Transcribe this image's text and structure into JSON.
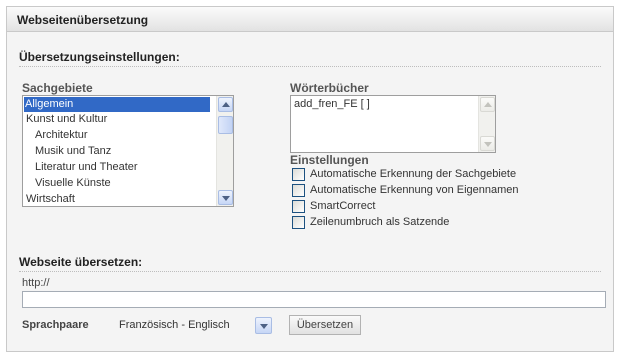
{
  "panel": {
    "title": "Webseitenübersetzung"
  },
  "settings": {
    "title": "Übersetzungseinstellungen:",
    "subject_areas": {
      "label": "Sachgebiete",
      "items": [
        {
          "label": "Allgemein",
          "selected": true
        },
        {
          "label": "Kunst und Kultur",
          "selected": false
        },
        {
          "label": "Architektur",
          "selected": false
        },
        {
          "label": "Musik und Tanz",
          "selected": false
        },
        {
          "label": "Literatur und Theater",
          "selected": false
        },
        {
          "label": "Visuelle Künste",
          "selected": false
        },
        {
          "label": "Wirtschaft",
          "selected": false
        }
      ]
    },
    "dictionaries": {
      "label": "Wörterbücher",
      "items": [
        {
          "label": "add_fren_FE [ ]"
        }
      ]
    },
    "options": {
      "label": "Einstellungen",
      "items": [
        {
          "label": "Automatische Erkennung der Sachgebiete",
          "checked": false
        },
        {
          "label": "Automatische Erkennung von Eigennamen",
          "checked": false
        },
        {
          "label": "SmartCorrect",
          "checked": false
        },
        {
          "label": "Zeilenumbruch als Satzende",
          "checked": false
        }
      ]
    }
  },
  "translate": {
    "title": "Webseite übersetzen:",
    "url_label": "http://",
    "url_value": "",
    "language_pair_label": "Sprachpaare",
    "language_pair_value": "Französisch - Englisch",
    "submit_label": "Übersetzen"
  },
  "icons": {
    "scroll_up": "chevron-up-icon",
    "scroll_down": "chevron-down-icon",
    "dropdown": "chevron-down-icon"
  },
  "colors": {
    "selection": "#3169c6",
    "checkbox_border": "#1c5180",
    "scroll_button": "#c6d6f6"
  }
}
